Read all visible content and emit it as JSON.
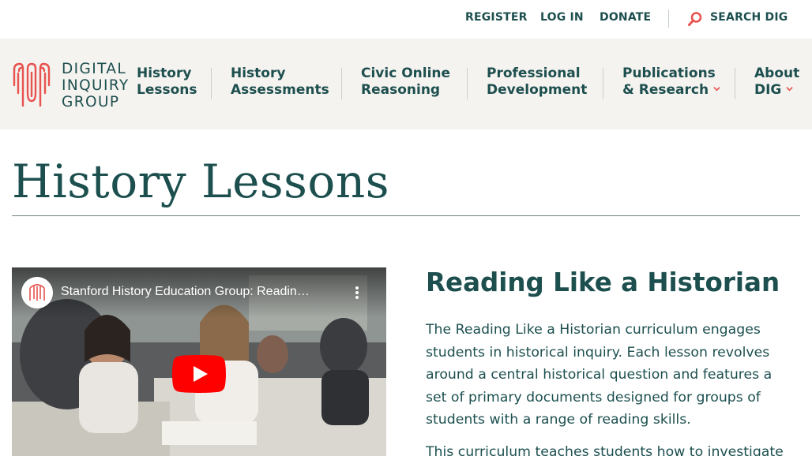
{
  "utility_bar": {
    "register": "REGISTER",
    "login": "LOG IN",
    "donate": "DONATE",
    "search": "SEARCH DIG",
    "search_icon": "search-icon"
  },
  "logo": {
    "line1": "DIGITAL",
    "line2": "INQUIRY",
    "line3": "GROUP",
    "mark_color": "#e8524f"
  },
  "nav": {
    "items": [
      {
        "line1": "History",
        "line2": "Lessons"
      },
      {
        "line1": "History",
        "line2": "Assessments"
      },
      {
        "line1": "Civic Online",
        "line2": "Reasoning"
      },
      {
        "line1": "Professional",
        "line2": "Development"
      },
      {
        "line1": "Publications",
        "line2": "& Research",
        "has_dropdown": true
      },
      {
        "line1": "About",
        "line2": "DIG",
        "has_dropdown": true
      }
    ],
    "dropdown_icon": "chevron-down-icon"
  },
  "page": {
    "title": "History Lessons"
  },
  "video": {
    "title": "Stanford History Education Group: Readin…",
    "play_icon": "youtube-play-icon",
    "menu_icon": "more-vertical-icon"
  },
  "article": {
    "title": "Reading Like a Historian",
    "paragraph1": "The Reading Like a Historian curriculum engages students in historical inquiry. Each lesson revolves around a central historical question and features a set of primary documents designed for groups of students with a range of reading skills.",
    "paragraph2": "This curriculum teaches students how to investigate"
  },
  "colors": {
    "brand": "#1d4f4f",
    "accent": "#e8524f",
    "nav_bg": "#f5f3ef",
    "play_red": "#ff0000"
  }
}
